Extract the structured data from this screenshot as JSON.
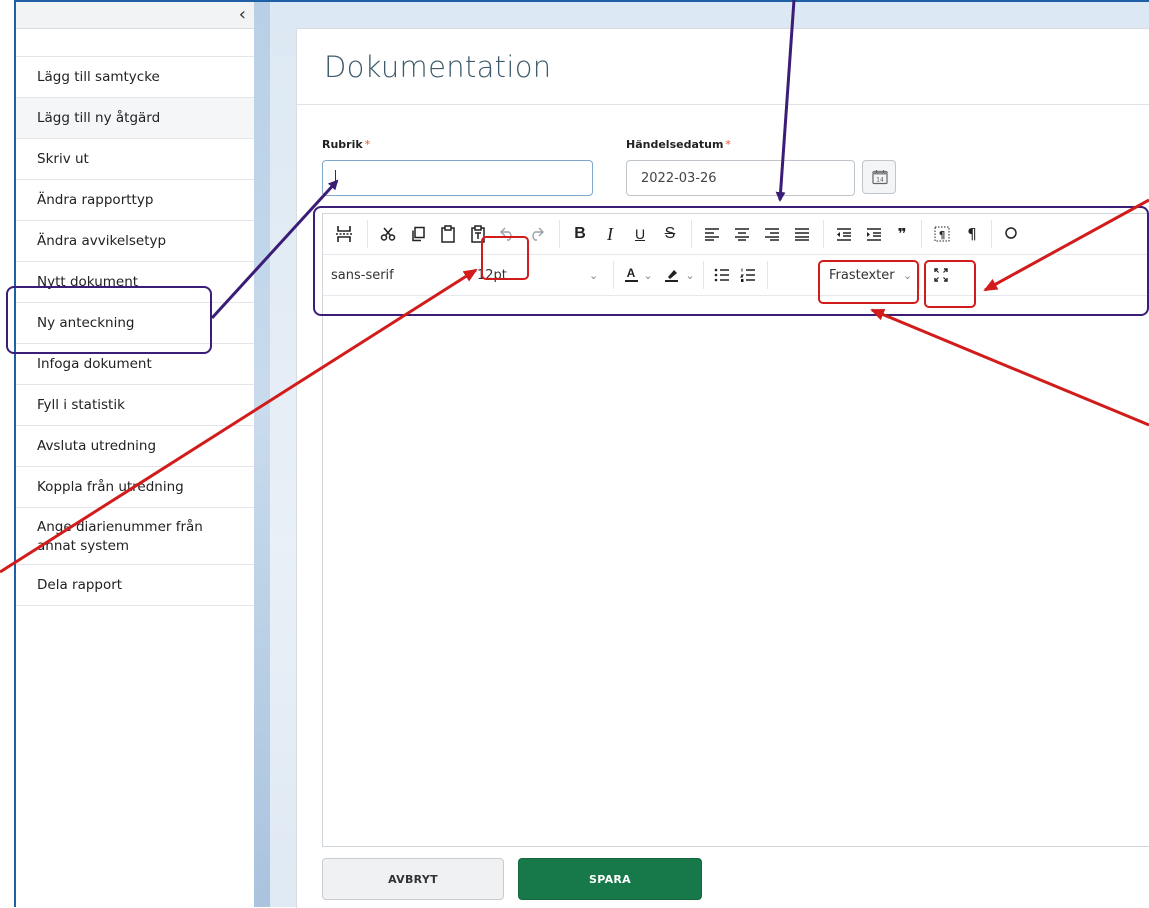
{
  "sidebar": {
    "collapse_glyph": "‹",
    "items": [
      {
        "label": "Lägg till samtycke"
      },
      {
        "label": "Lägg till ny åtgärd"
      },
      {
        "label": "Skriv ut"
      },
      {
        "label": "Ändra rapporttyp"
      },
      {
        "label": "Ändra avvikelsetyp"
      },
      {
        "label": "Nytt dokument"
      },
      {
        "label": "Ny anteckning"
      },
      {
        "label": "Infoga dokument"
      },
      {
        "label": "Fyll i statistik"
      },
      {
        "label": "Avsluta utredning"
      },
      {
        "label": "Koppla från utredning"
      },
      {
        "label": "Ange diarienummer från annat system"
      },
      {
        "label": "Dela rapport"
      }
    ]
  },
  "page": {
    "title": "Dokumentation"
  },
  "form": {
    "rubrik_label": "Rubrik",
    "rubrik_value": "",
    "date_label": "Händelsedatum",
    "date_value": "2022-03-26",
    "required_mark": "*"
  },
  "editor": {
    "font_family": "sans-serif",
    "font_size": "12pt",
    "phrase_dropdown": "Frastexter",
    "icons": {
      "page_break": "page-break-icon",
      "cut": "cut-icon",
      "copy": "copy-icon",
      "paste": "paste-icon",
      "paste_text": "paste-as-text-icon",
      "undo": "undo-icon",
      "redo": "redo-icon",
      "bold": "bold-icon",
      "italic": "italic-icon",
      "underline": "underline-icon",
      "strikethrough": "strikethrough-icon",
      "fullscreen": "fullscreen-icon"
    },
    "glyphs": {
      "bold": "B",
      "italic": "I",
      "underline": "U",
      "strikethrough": "S",
      "font_color": "A",
      "blockquote": "❞",
      "pilcrow": "¶"
    }
  },
  "buttons": {
    "cancel": "AVBRYT",
    "save": "SPARA"
  },
  "colors": {
    "primary_save": "#17784a",
    "annotation_purple": "#3b1d78",
    "annotation_red": "#d21c1c",
    "title_color": "#3c5a6a"
  }
}
